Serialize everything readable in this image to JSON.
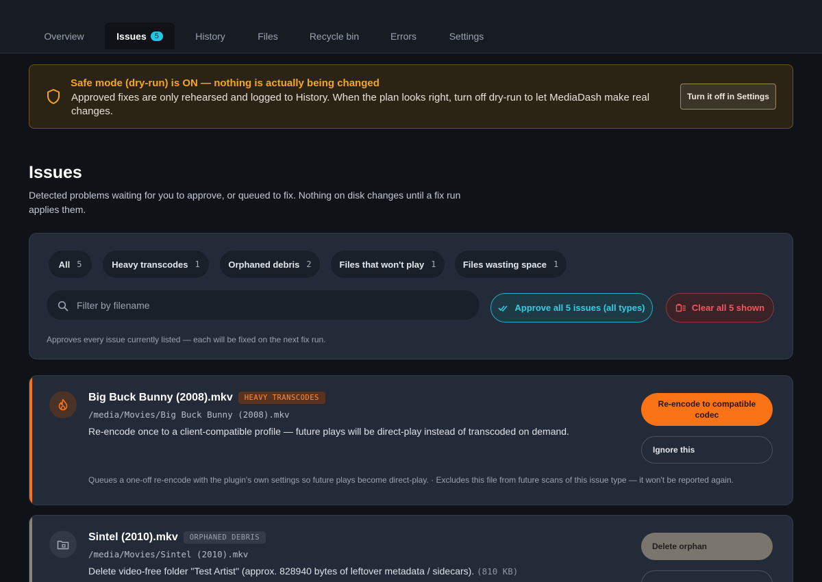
{
  "tabs": [
    {
      "label": "Overview"
    },
    {
      "label": "Issues",
      "badge": "5"
    },
    {
      "label": "History"
    },
    {
      "label": "Files"
    },
    {
      "label": "Recycle bin"
    },
    {
      "label": "Errors"
    },
    {
      "label": "Settings"
    }
  ],
  "active_tab": "Issues",
  "banner": {
    "icon": "shield-icon",
    "title": "Safe mode (dry-run) is ON — nothing is actually being changed",
    "text": "Approved fixes are only rehearsed and logged to History. When the plan looks right, turn off dry-run to let MediaDash make real changes.",
    "button": "Turn it off in Settings"
  },
  "page": {
    "title": "Issues",
    "description": "Detected problems waiting for you to approve, or queued to fix. Nothing on disk changes until a fix run applies them."
  },
  "filters": {
    "chips": [
      {
        "label": "All",
        "count": "5"
      },
      {
        "label": "Heavy transcodes",
        "count": "1"
      },
      {
        "label": "Orphaned debris",
        "count": "2"
      },
      {
        "label": "Files that won't play",
        "count": "1"
      },
      {
        "label": "Files wasting space",
        "count": "1"
      }
    ],
    "search_placeholder": "Filter by filename",
    "approve_all": "Approve all 5 issues (all types)",
    "clear_all": "Clear all 5 shown",
    "hint": "Approves every issue currently listed — each will be fixed on the next fix run."
  },
  "issues": [
    {
      "title": "Big Buck Bunny (2008).mkv",
      "badge": "HEAVY TRANSCODES",
      "path": "/media/Movies/Big Buck Bunny (2008).mkv",
      "description": "Re-encode once to a client-compatible profile — future plays will be direct-play instead of transcoded on demand.",
      "primary_action": "Re-encode to compatible codec",
      "secondary_action": "Ignore this",
      "footer": "Queues a one-off re-encode with the plugin's own settings so future plays become direct-play. · Excludes this file from future scans of this issue type — it won't be reported again.",
      "icon": "flame-icon",
      "accent": "#f97316"
    },
    {
      "title": "Sintel (2010).mkv",
      "badge": "ORPHANED DEBRIS",
      "path": "/media/Movies/Sintel (2010).mkv",
      "description": "Delete video-free folder \"Test Artist\" (approx. 828940 bytes of leftover metadata / sidecars).",
      "size": "(810 KB)",
      "primary_action": "Delete orphan",
      "icon": "folder-icon",
      "accent": "#8a8478"
    }
  ],
  "colors": {
    "background": "#0f1217",
    "panel": "#242b38",
    "warning": "#f5a524",
    "info": "#22c7e8",
    "danger": "#f0575f",
    "transcode": "#f97316"
  }
}
